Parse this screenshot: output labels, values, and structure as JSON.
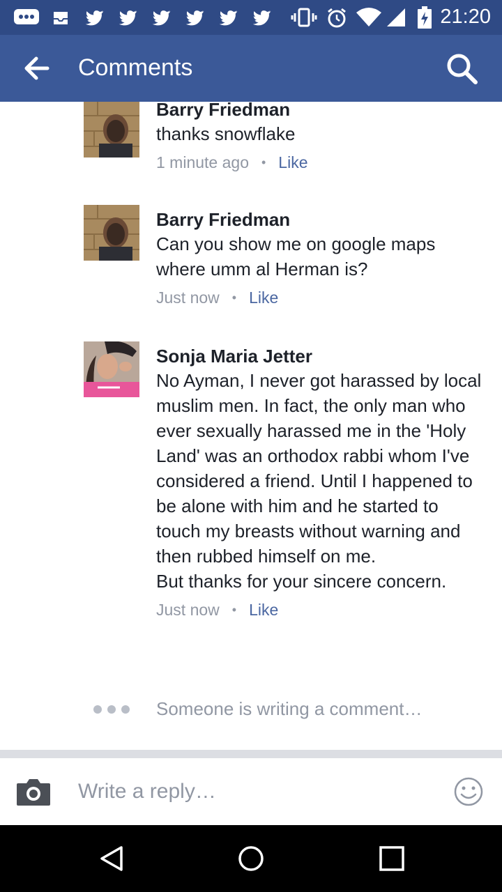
{
  "status_bar": {
    "time": "21:20",
    "icons": [
      "messenger-dots-icon",
      "inbox-icon",
      "twitter-bird-icon",
      "twitter-bird-icon",
      "twitter-bird-icon",
      "twitter-bird-icon",
      "twitter-bird-icon",
      "twitter-bird-icon",
      "vibrate-icon",
      "alarm-icon",
      "wifi-icon",
      "signal-icon",
      "battery-charging-icon"
    ]
  },
  "header": {
    "title": "Comments",
    "back_icon": "arrow-left-icon",
    "search_icon": "search-icon",
    "color": "#3b5998"
  },
  "comments": [
    {
      "author": "Barry Friedman",
      "text": "thanks snowflake",
      "time": "1 minute ago",
      "like_label": "Like"
    },
    {
      "author": "Barry Friedman",
      "text": "Can you show me on google maps where umm al Herman is?",
      "time": "Just now",
      "like_label": "Like"
    },
    {
      "author": "Sonja Maria Jetter",
      "text": "No Ayman, I never got harassed by local muslim men. In fact, the only man who ever sexually harassed me in the 'Holy Land' was an orthodox rabbi whom I've considered a friend. Until I happened to be alone with him and he started to touch my breasts without warning and then rubbed himself on me.\nBut thanks for your sincere concern.",
      "time": "Just now",
      "like_label": "Like"
    }
  ],
  "typing_indicator": "Someone is writing a comment…",
  "composer": {
    "placeholder": "Write a reply…",
    "camera_icon": "camera-icon",
    "emoji_icon": "smiley-icon"
  },
  "nav": [
    "back-triangle-icon",
    "home-circle-icon",
    "recents-square-icon"
  ],
  "colors": {
    "accent": "#3b5998",
    "link": "#4b67a1",
    "muted": "#9197a3"
  }
}
